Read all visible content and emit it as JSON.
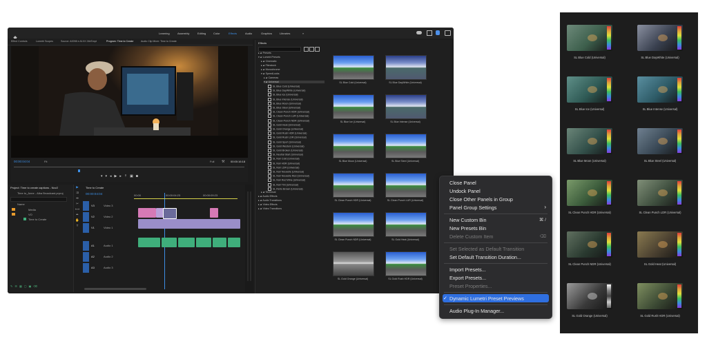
{
  "workspaces": [
    "Learning",
    "Assembly",
    "Editing",
    "Color",
    "Effects",
    "Audio",
    "Graphics",
    "Libraries"
  ],
  "active_workspace": "Effects",
  "panel_tabs": [
    "Effect Controls",
    "Lumetri Scopes",
    "Source: A0098 e A1XX 24lrEmpt",
    "Program: Time to Create",
    "Audio Clip Mixer: Time to Create"
  ],
  "program": {
    "timecode_left": "00:00:04:04",
    "fit": "Fit",
    "full": "Full",
    "timecode_right": "00:00:16:18"
  },
  "effects_panel": {
    "title": "Effects",
    "tree": [
      "Presets",
      "Lumetri Presets",
      "Cinematic",
      "Filmstock",
      "Monochrome",
      "SpeedLooks",
      "Cameras",
      "Universal"
    ],
    "universal_items": [
      "SL Blue Cold (Universal)",
      "SL Blue DayWhite (Universal)",
      "SL Blue Ice (Universal)",
      "SL Blue Intense (Universal)",
      "SL Blue Moon (Universal)",
      "SL Blue Steel (Universal)",
      "SL Clean Punch HDR (Universal)",
      "SL Clean Punch LUR (Universal)",
      "SL Clean Punch NDR (Universal)",
      "SL Gold Heat (Universal)",
      "SL Gold Orange (Universal)",
      "SL Gold Rush HDR (Universal)",
      "SL Gold Rush LDR (Universal)",
      "SL Gold Sport (Universal)",
      "SL Gold Western (Universal)",
      "SL Gold Broken (Universal)",
      "SL Neutral Start (Universal)",
      "SL Noir Cold (Universal)",
      "SL Noir HDR (Universal)",
      "SL Noir LDR (Universal)",
      "SL Noir Nouvelle (Universal)",
      "SL Noir Nouvelle Red (Universal)",
      "SL Noir Red Wine (Universal)",
      "SL Noir Tint (Universal)",
      "SL Retro Brown (Universal)"
    ],
    "more_tree": [
      "Technical",
      "Audio Effects",
      "Audio Transitions",
      "Video Effects",
      "Video Transitions"
    ],
    "thumb_labels": [
      "SL Blue Cold (Universal)",
      "SL Blue DayWhite (Universal)",
      "SL Blue Ice (Universal)",
      "SL Blue Intense (Universal)",
      "SL Blue Moon (Universal)",
      "SL Blue Steel (Universal)",
      "SL Clean Punch HDR (Universal)",
      "SL Clean Punch LUR (Universal)",
      "SL Clean Punch NDR (Universal)",
      "SL Gold Heat (Universal)",
      "SL Gold Orange (Universal)",
      "SL Gold Rush HDR (Universal)"
    ]
  },
  "project": {
    "title": "Project: Time to create captions - Nov2",
    "file": "Time to_Anne - Alba Broadcast.prproj",
    "name_header": "Name",
    "items": [
      "Media",
      "VO",
      "Time to Create"
    ]
  },
  "timeline": {
    "title": "Time to Create",
    "timecode": "00:00:04:04",
    "ruler": [
      "00:00",
      "00:00:04:23",
      "00:00:09:23"
    ],
    "tracks": [
      "V3",
      "V2",
      "V1",
      "A1",
      "A2",
      "A3"
    ],
    "track_names": [
      "Video 3",
      "Video 2",
      "Video 1",
      "Audio 1",
      "Audio 2",
      "Audio 3"
    ]
  },
  "context_menu": {
    "items": [
      {
        "label": "Close Panel",
        "disabled": false
      },
      {
        "label": "Undock Panel",
        "disabled": false
      },
      {
        "label": "Close Other Panels in Group",
        "disabled": false
      },
      {
        "label": "Panel Group Settings",
        "disabled": false,
        "submenu": true
      },
      {
        "label": "New Custom Bin",
        "disabled": false,
        "shortcut": "⌘ /"
      },
      {
        "label": "New Presets Bin",
        "disabled": false
      },
      {
        "label": "Delete Custom Item",
        "disabled": true,
        "shortcut": "⌫"
      },
      {
        "label": "Set Selected as Default Transition",
        "disabled": true
      },
      {
        "label": "Set Default Transition Duration...",
        "disabled": false
      },
      {
        "label": "Import Presets...",
        "disabled": false
      },
      {
        "label": "Export Presets...",
        "disabled": false
      },
      {
        "label": "Preset Properties...",
        "disabled": true
      },
      {
        "label": "Dynamic Lumetri Preset Previews",
        "disabled": false,
        "checked": true,
        "highlighted": true
      },
      {
        "label": "Audio Plug-In Manager...",
        "disabled": false
      }
    ],
    "check_glyph": "✓",
    "submenu_glyph": "›"
  },
  "preview_panel": {
    "labels": [
      "SL Blue Cold (Universal)",
      "SL Blue DayWhite (Universal)",
      "SL Blue Ice (Universal)",
      "SL Blue Intense (Universal)",
      "SL Blue Moon (Universal)",
      "SL Blue Steel (Universal)",
      "SL Clean Punch HDR (Universal)",
      "SL Clean Punch LDR (Universal)",
      "SL Clean Punch NDR (Universal)",
      "SL Gold Heat (Universal)",
      "SL Gold Orange (Universal)",
      "SL Gold Rush HDR (Universal)"
    ]
  },
  "colors": {
    "accent": "#2f6fe0",
    "active_workspace": "#3d8fe6",
    "clip_video": "#9a8ec9",
    "clip_pink": "#d67ab6",
    "clip_audio": "#3fae7b",
    "track_target": "#2b5fa8"
  }
}
